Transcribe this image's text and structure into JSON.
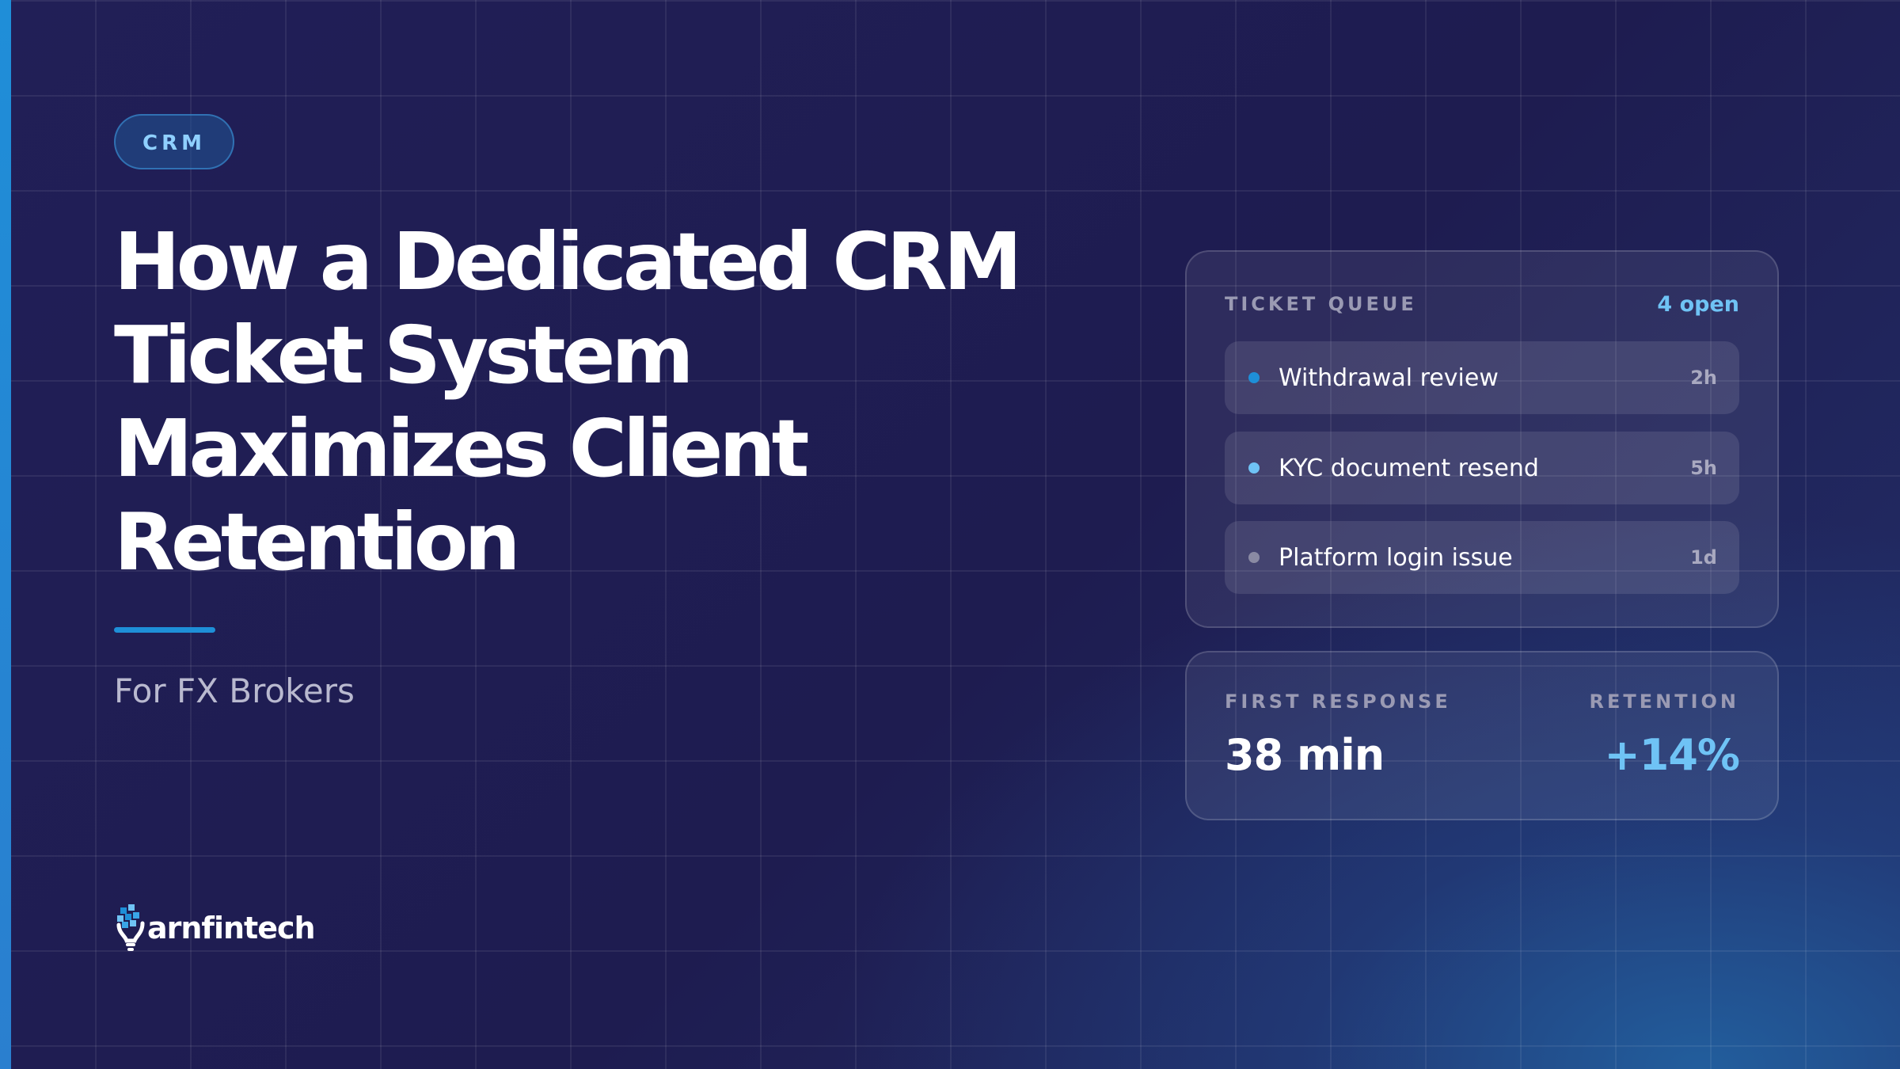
{
  "badge": "CRM",
  "headline": {
    "lines": [
      "How a Dedicated CRM",
      "Ticket System",
      "Maximizes Client",
      "Retention"
    ]
  },
  "subtitle": "For FX Brokers",
  "logo": {
    "text": "arnfintech",
    "icon": "lightbulb-pixel-icon"
  },
  "ticket_queue": {
    "label": "TICKET QUEUE",
    "open_count": "4 open",
    "tickets": [
      {
        "name": "Withdrawal review",
        "age": "2h",
        "dot_color": "#1e8fd8"
      },
      {
        "name": "KYC document resend",
        "age": "5h",
        "dot_color": "#6fc3f5"
      },
      {
        "name": "Platform login issue",
        "age": "1d",
        "dot_color": "#8a8aa3"
      }
    ]
  },
  "metrics": {
    "first_response": {
      "label": "FIRST RESPONSE",
      "value": "38 min"
    },
    "retention": {
      "label": "RETENTION",
      "value": "+14%"
    }
  },
  "colors": {
    "accent": "#1e8fd8",
    "accent_light": "#6fc3f5",
    "background": "#1f1d52",
    "text_primary": "#ffffff",
    "text_muted": "#9a9ab3"
  }
}
